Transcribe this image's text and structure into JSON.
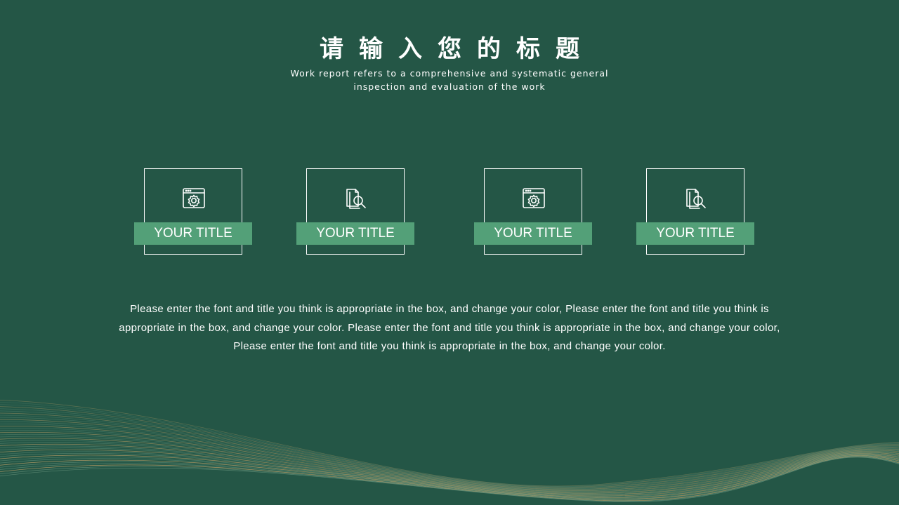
{
  "slide": {
    "title": "请输入您的标题",
    "subtitle": "Work report refers to a comprehensive and systematic general inspection and evaluation of the work",
    "cards": [
      {
        "label": "YOUR TITLE",
        "icon": "browser-gear-icon"
      },
      {
        "label": "YOUR TITLE",
        "icon": "document-search-icon"
      },
      {
        "label": "YOUR TITLE",
        "icon": "browser-gear-icon"
      },
      {
        "label": "YOUR TITLE",
        "icon": "document-search-icon"
      }
    ],
    "body": "Please enter the font and title you think is appropriate in the box, and change your color, Please enter the font and title you think is appropriate in the box, and change your color. Please enter the font and title you think is appropriate in the box, and change your color, Please enter the font and title you think is appropriate in the box, and change your color."
  },
  "colors": {
    "background": "#245646",
    "label_fill": "#53a078",
    "line_gold": "#c9a66b",
    "line_green": "#5f8c76"
  }
}
